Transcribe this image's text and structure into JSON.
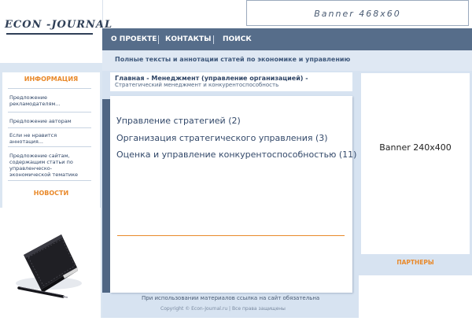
{
  "logo": {
    "text": "ECON -JOURNAL"
  },
  "banner_top": {
    "label": "Banner 468x60"
  },
  "nav": {
    "items": [
      {
        "label": "О ПРОЕКТЕ"
      },
      {
        "label": "КОНТАКТЫ"
      },
      {
        "label": "ПОИСК"
      }
    ]
  },
  "tagline": "Полные тексты и аннотации статей по экономике и управлению",
  "sidebar": {
    "info_title": "ИНФОРМАЦИЯ",
    "links": [
      {
        "label": "Предложение рекламодателям..."
      },
      {
        "label": "Предложение авторам"
      },
      {
        "label": "Если не нравится аннотация..."
      },
      {
        "label": "Предложение сайтам, содержащим статьи по управленческо-экономической тематике"
      }
    ],
    "news_title": "НОВОСТИ"
  },
  "breadcrumb": {
    "main": "Главная - Менеджмент (управление организацией) -",
    "sub": "Стратегический менеджмент и конкурентоспособность"
  },
  "categories": [
    {
      "label": "Управление стратегией (2)"
    },
    {
      "label": "Организация стратегического управления (3)"
    },
    {
      "label": "Оценка и управление конкурентоспособностью (11)"
    }
  ],
  "footer": {
    "note": "При использовании материалов ссылка на сайт обязательна",
    "copyright": "Copyright © Econ-Journal.ru   |   Все права защищены"
  },
  "banner_right": {
    "label": "Banner 240x400"
  },
  "partners_title": "ПАРТНЕРЫ",
  "colors": {
    "nav_bg": "#566d8a",
    "accent_orange": "#e9892a",
    "panel_blue": "#d7e3f1",
    "text_dark_blue": "#2f4566"
  }
}
